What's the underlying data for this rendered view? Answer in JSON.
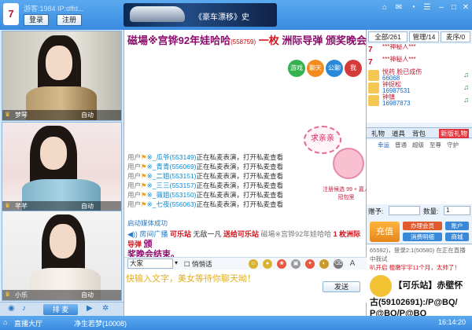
{
  "title": {
    "logo": "7",
    "user": "游客:1984 IP:dffd...",
    "login": "登录",
    "register": "注册"
  },
  "banner": {
    "text": "《豪车漂移》史"
  },
  "window": {
    "ctrl_icons": [
      "skin-icon",
      "message-icon",
      "wifi-icon",
      "settings-icon",
      "minimize-icon",
      "maximize-icon",
      "close-icon"
    ]
  },
  "videos": [
    {
      "name": "梦琴",
      "auto": "自动"
    },
    {
      "name": "芊芊",
      "auto": "自动"
    },
    {
      "name": "小乐",
      "auto": "自动"
    }
  ],
  "mic": {
    "label": "排 麦"
  },
  "marquee": {
    "p1": "磁場※宫铧92年娃哈哈",
    "num": "(558759)",
    "p2": "一枚",
    "p3": "洲际导弹",
    "p4": "颁奖晚会结束。"
  },
  "modes": {
    "m1": "游戏中心",
    "m2": "聊天",
    "m3": "公聊",
    "m4": "我"
  },
  "bubble": "求亲亲",
  "pig_caption": "注册候选 99 + 嘉人冠包里",
  "sys": [
    {
      "pre": "用户",
      "name": "※_瓜爷(553149)",
      "act": "正在私麦表演，打开私麦查看"
    },
    {
      "pre": "用户",
      "name": "※_青青(556069)",
      "act": "正在私麦表演，打开私麦查看"
    },
    {
      "pre": "用户",
      "name": "※_二姐(553151)",
      "act": "正在私麦表演，打开私麦查看"
    },
    {
      "pre": "用户",
      "name": "※_三三(553157)",
      "act": "正在私麦表演，打开私麦查看"
    },
    {
      "pre": "用户",
      "name": "※_薇姐(553150)",
      "act": "正在私麦表演，打开私麦查看"
    },
    {
      "pre": "用户",
      "name": "※_七夜(556063)",
      "act": "正在私麦表演，打开私麦查看"
    }
  ],
  "effect_ok": "启动媒体成功",
  "broadcast": {
    "a": "◀)) 房间广播",
    "b": "可乐站",
    "c": "无敌一凡",
    "d": "送给可乐站",
    "e": "磁場※宫铧92年娃哈哈",
    "f": "1 枚洲际导弹",
    "g": "颁",
    "h": "奖晚会结束。"
  },
  "chat_tools": {
    "font": "大家",
    "whisper": "悄悄话"
  },
  "chat_input": {
    "placeholder": "快输入文字，美女等待你聊天呦！",
    "send": "发送"
  },
  "right_tabs": {
    "all": "全部/261",
    "manager": "管理/14",
    "mic": "麦序/0"
  },
  "users": [
    {
      "n1": "***神秘人***",
      "n2": ""
    },
    {
      "n1": "***神秘人***",
      "n2": ""
    },
    {
      "n1": "悦药 脸已成伤",
      "n2": "66068"
    },
    {
      "n1": "钟捉松",
      "n2": "16987531"
    },
    {
      "n1": "钟镇",
      "n2": "16987873"
    }
  ],
  "gift_tabs": {
    "t1": "礼物",
    "t2": "道具",
    "t3": "背包",
    "t4": "新版礼物"
  },
  "gift_subtabs": {
    "s1": "幸运",
    "s2": "普通",
    "s3": "超级",
    "s4": "至尊",
    "s5": "守护"
  },
  "gift_form": {
    "to": "赠予:",
    "qty": "数量:",
    "qty_val": "1"
  },
  "recharge": {
    "label": "充值",
    "b1": "办理会员",
    "b2": "账户",
    "b3": "消费明细",
    "b4": "商城"
  },
  "promo": {
    "l1": "65592)，登录2:1(50580) 在正在直播中我试",
    "l2": "叭开启 棍嫩宇宇11个月，太帅了！",
    "l3": "【可乐站】赤壁怀",
    "l4": "古(59102691):/P@BQ/",
    "l5": "P@BQ/P@BQ"
  },
  "status": {
    "hall": "直播大厅",
    "room": "净生若梦(10008)",
    "time": "16:14:20"
  }
}
